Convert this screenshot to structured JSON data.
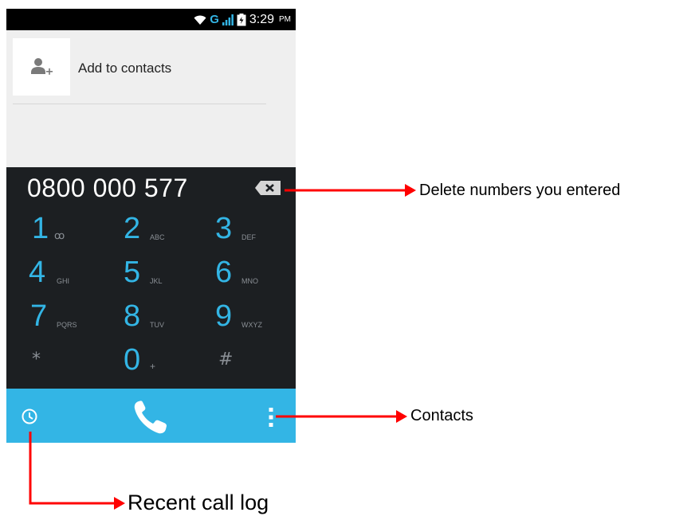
{
  "status_bar": {
    "network": "G",
    "time": "3:29",
    "ampm": "PM",
    "icons": [
      "wifi-icon",
      "signal-icon",
      "battery-icon"
    ]
  },
  "contact_suggestion": {
    "label": "Add to contacts",
    "icon": "add-contact-icon"
  },
  "dialer": {
    "number": "0800 000 577",
    "delete_icon": "backspace-icon",
    "keys": [
      {
        "digit": "1",
        "letters": "ꝏ"
      },
      {
        "digit": "2",
        "letters": "ABC"
      },
      {
        "digit": "3",
        "letters": "DEF"
      },
      {
        "digit": "4",
        "letters": "GHI"
      },
      {
        "digit": "5",
        "letters": "JKL"
      },
      {
        "digit": "6",
        "letters": "MNO"
      },
      {
        "digit": "7",
        "letters": "PQRS"
      },
      {
        "digit": "8",
        "letters": "TUV"
      },
      {
        "digit": "9",
        "letters": "WXYZ"
      },
      {
        "digit": "*",
        "letters": ""
      },
      {
        "digit": "0",
        "letters": "+"
      },
      {
        "digit": "#",
        "letters": ""
      }
    ]
  },
  "bottom_bar": {
    "left_icon": "clock-icon",
    "center_icon": "phone-icon",
    "right_icon": "overflow-menu-icon"
  },
  "annotations": {
    "delete": "Delete numbers you entered",
    "contacts": "Contacts",
    "recent": "Recent call log"
  },
  "colors": {
    "accent": "#33b5e5",
    "dialpad_bg": "#1c1f22",
    "arrow": "#ff0000"
  }
}
